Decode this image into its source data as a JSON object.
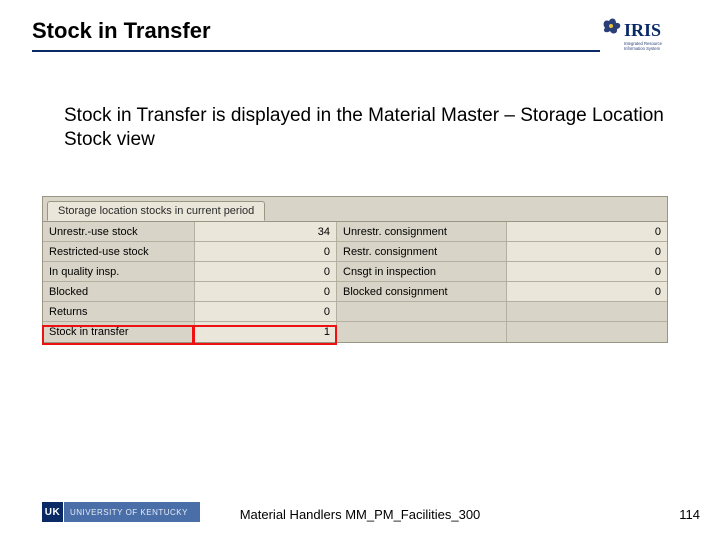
{
  "header": {
    "title": "Stock in Transfer",
    "logo_text": "IRIS",
    "logo_sub": "Integrated Resource Information System"
  },
  "body": {
    "text": "Stock in Transfer is displayed in the Material Master – Storage Location Stock view"
  },
  "sap": {
    "tab_label": "Storage location stocks in current period",
    "rows": [
      {
        "label1": "Unrestr.-use stock",
        "value1": "34",
        "label2": "Unrestr. consignment",
        "value2": "0"
      },
      {
        "label1": "Restricted-use stock",
        "value1": "0",
        "label2": "Restr. consignment",
        "value2": "0"
      },
      {
        "label1": "In quality insp.",
        "value1": "0",
        "label2": "Cnsgt in inspection",
        "value2": "0"
      },
      {
        "label1": "Blocked",
        "value1": "0",
        "label2": "Blocked consignment",
        "value2": "0"
      },
      {
        "label1": "Returns",
        "value1": "0",
        "label2": "",
        "value2": ""
      },
      {
        "label1": "Stock in transfer",
        "value1": "1",
        "label2": "",
        "value2": ""
      }
    ]
  },
  "footer": {
    "uk_square": "UK",
    "uk_bar": "UNIVERSITY OF KENTUCKY",
    "center": "Material Handlers MM_PM_Facilities_300",
    "page": "114"
  }
}
